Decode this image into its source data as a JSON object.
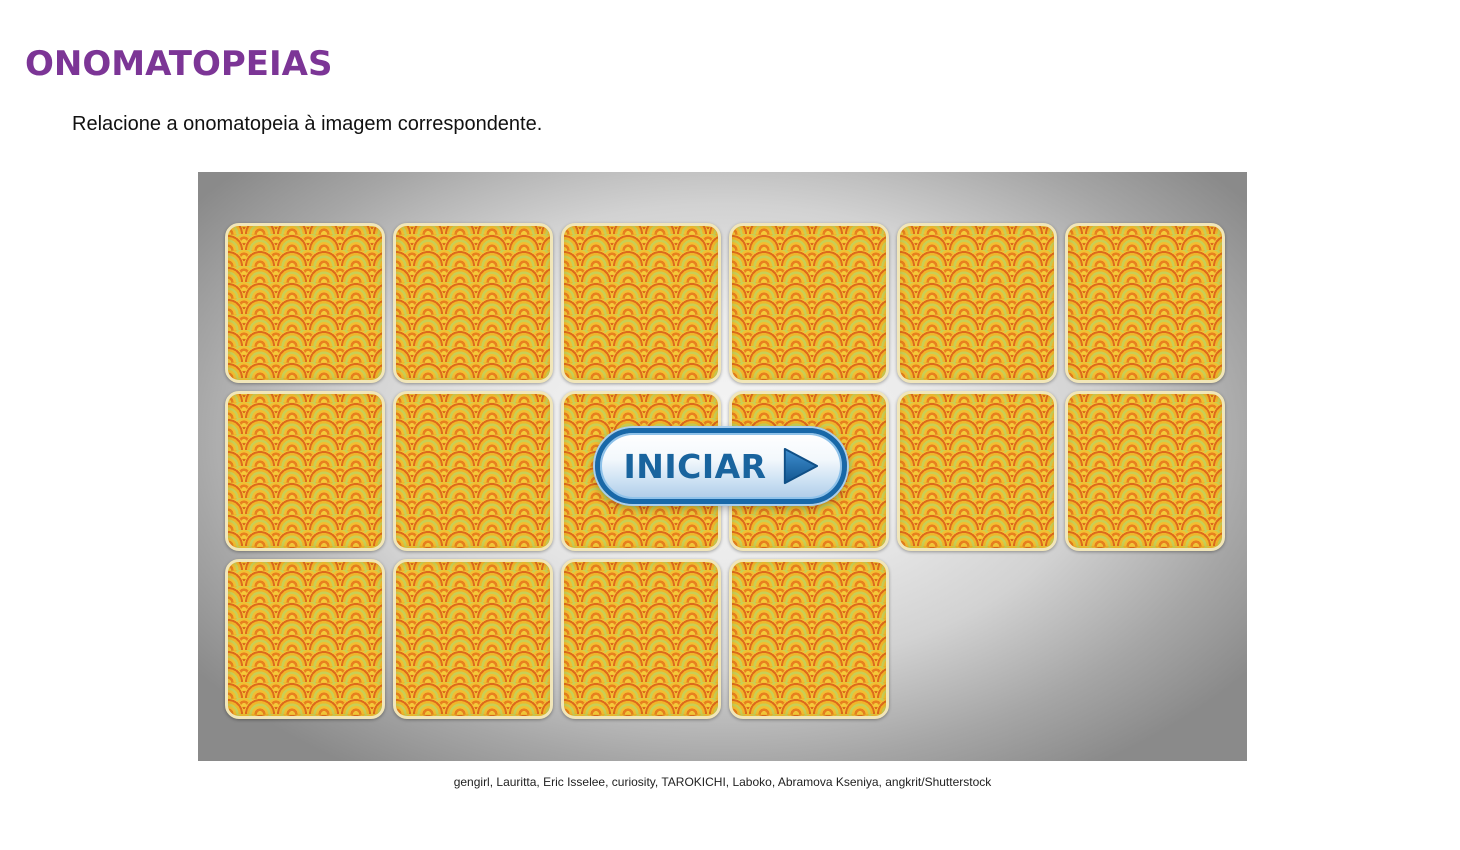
{
  "page": {
    "title": "ONOMATOPEIAS",
    "instruction": "Relacione a onomatopeia à imagem correspondente.",
    "credits": "gengirl, Lauritta, Eric Isselee, curiosity, TAROKICHI, Laboko, Abramova Kseniya, angkrit/Shutterstock"
  },
  "game": {
    "start_button_label": "INICIAR",
    "start_button_icon": "play-arrow-icon",
    "card_count": 16,
    "cards_face_down": 16,
    "colors": {
      "title": "#7c3596",
      "button_border": "#1868a8",
      "button_text": "#19649e",
      "card_pattern_primary": "#f0b62a",
      "card_pattern_accent": "#dd6a1d",
      "card_pattern_green": "#c9cf55"
    }
  }
}
